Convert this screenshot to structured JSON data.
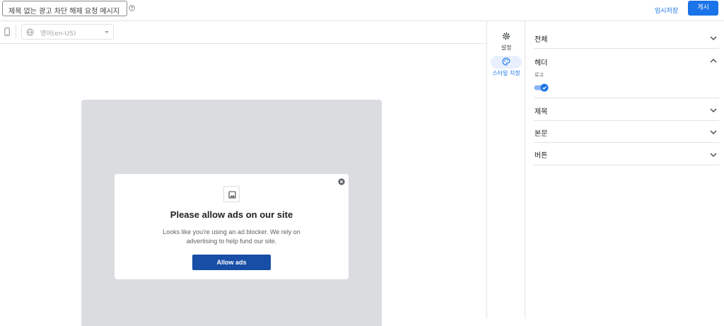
{
  "header": {
    "title_value": "제목 없는 광고 차단 해제 요청 메시지",
    "help_icon": "help-circle-icon",
    "save_draft_label": "임시저장",
    "publish_label": "게시",
    "accent_color": "#1a73e8"
  },
  "toolbar": {
    "device_icon": "mobile-device-icon",
    "language_icon": "globe-icon",
    "language_value": "영어(en-US)"
  },
  "preview": {
    "overlay_color": "#dadce0",
    "image_icon": "image-icon",
    "close_icon": "close-circle-icon",
    "dialog_title": "Please allow ads on our site",
    "dialog_body": "Looks like you're using an ad blocker. We rely on advertising to help fund our site.",
    "button_label": "Allow ads",
    "button_color": "#174ea6"
  },
  "rail": {
    "items": [
      {
        "label": "설정",
        "icon": "gear-icon",
        "active": false
      },
      {
        "label": "스타일 지정",
        "icon": "palette-icon",
        "active": true
      }
    ]
  },
  "panel": {
    "sections": [
      {
        "title": "전체",
        "expanded": false
      },
      {
        "title": "헤더",
        "expanded": true,
        "fields": [
          {
            "label": "로고",
            "toggle_on": true
          }
        ]
      },
      {
        "title": "제목",
        "expanded": false
      },
      {
        "title": "본문",
        "expanded": false
      },
      {
        "title": "버튼",
        "expanded": false
      }
    ]
  }
}
